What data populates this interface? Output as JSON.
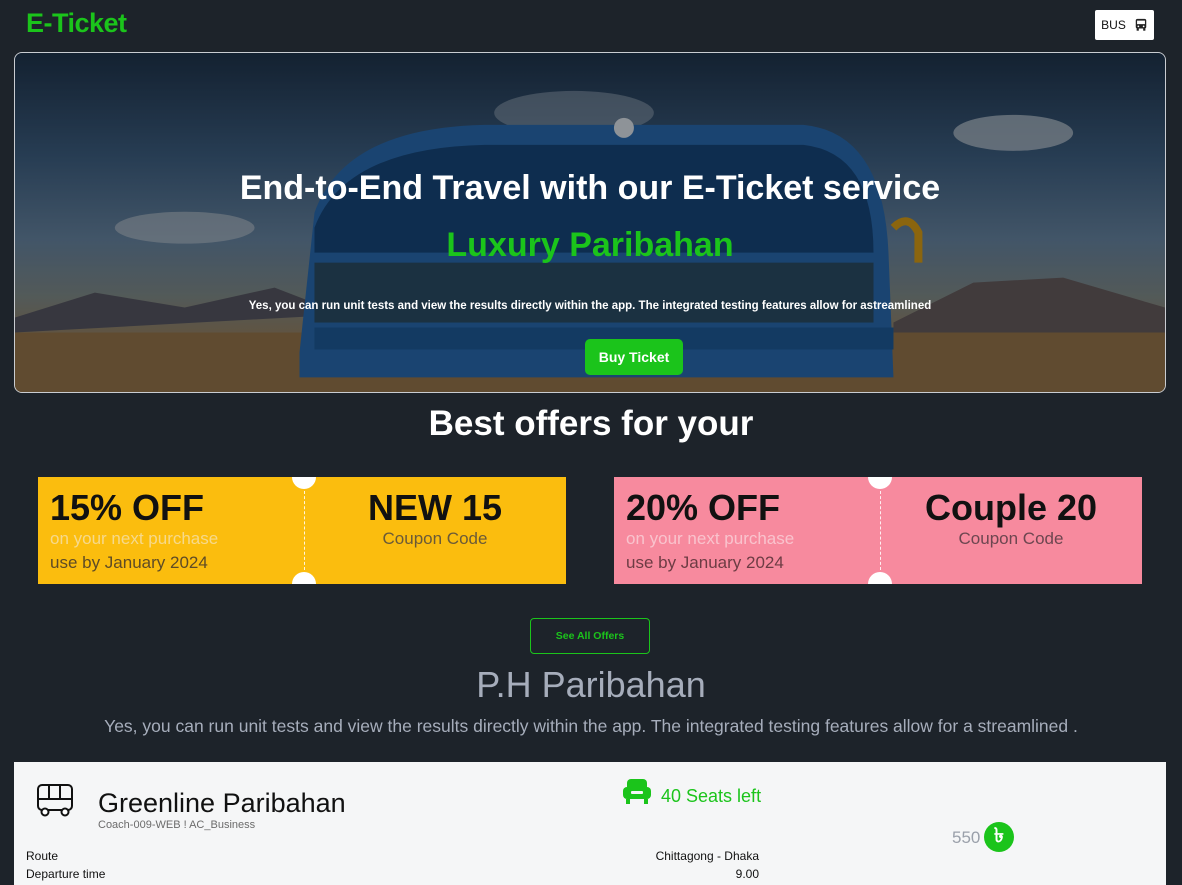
{
  "header": {
    "logo": "E-Ticket",
    "bus_button_label": "BUS"
  },
  "hero": {
    "title": "End-to-End Travel with our E-Ticket service",
    "subtitle": "Luxury Paribahan",
    "description": "Yes, you can run unit tests and view the results directly within the app. The integrated testing features allow for astreamlined",
    "cta_label": "Buy Ticket"
  },
  "offers": {
    "title": "Best offers for your",
    "coupons": [
      {
        "discount": "15% OFF",
        "note": "on your next purchase",
        "valid": "use by January 2024",
        "code": "NEW 15",
        "code_label": "Coupon Code",
        "color": "#fbbd0e"
      },
      {
        "discount": "20% OFF",
        "note": "on your next purchase",
        "valid": "use by January 2024",
        "code": "Couple 20",
        "code_label": "Coupon Code",
        "color": "#f78a9e"
      }
    ],
    "see_all_label": "See All Offers"
  },
  "operator": {
    "title": "P.H Paribahan",
    "description": "Yes, you can run unit tests and view the results directly within the app. The integrated testing features allow for a streamlined ."
  },
  "bus_card": {
    "name": "Greenline Paribahan",
    "coach": "Coach-009-WEB ! AC_Business",
    "seats_left": "40 Seats left",
    "rows": [
      {
        "label": "Route",
        "value": "Chittagong - Dhaka"
      },
      {
        "label": "Departure time",
        "value": "9.00"
      }
    ],
    "price": "550",
    "currency_symbol": "৳"
  },
  "colors": {
    "accent": "#1bc41b",
    "background": "#1d232a",
    "coupon_yellow": "#fbbd0e",
    "coupon_pink": "#f78a9e"
  }
}
